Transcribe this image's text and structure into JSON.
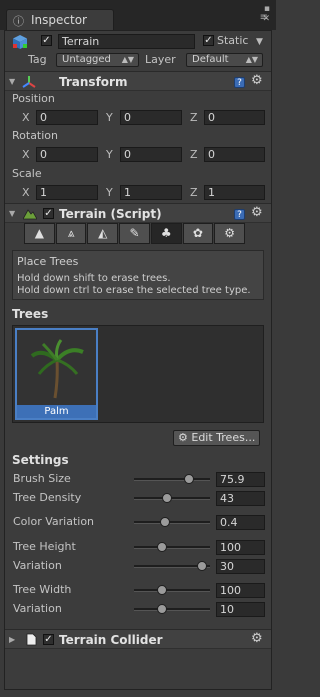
{
  "window": {
    "tab_label": "Inspector",
    "tab_icon": "info-icon"
  },
  "object": {
    "icon": "gameobject-cube-icon",
    "active": true,
    "name": "Terrain",
    "static_checked": true,
    "static_label": "Static",
    "tag_label": "Tag",
    "tag_value": "Untagged",
    "layer_label": "Layer",
    "layer_value": "Default"
  },
  "transform": {
    "title": "Transform",
    "position_label": "Position",
    "rotation_label": "Rotation",
    "scale_label": "Scale",
    "axis_x": "X",
    "axis_y": "Y",
    "axis_z": "Z",
    "position": {
      "x": "0",
      "y": "0",
      "z": "0"
    },
    "rotation": {
      "x": "0",
      "y": "0",
      "z": "0"
    },
    "scale": {
      "x": "1",
      "y": "1",
      "z": "1"
    }
  },
  "terrain_script": {
    "title": "Terrain (Script)",
    "enabled": true,
    "tools": [
      "raise-lower-icon",
      "paint-height-icon",
      "smooth-height-icon",
      "paint-texture-icon",
      "place-trees-icon",
      "paint-details-icon",
      "settings-icon"
    ],
    "active_tool_index": 4,
    "help_title": "Place Trees",
    "help_line1": "Hold down shift to erase trees.",
    "help_line2": "Hold down ctrl to erase the selected tree type.",
    "trees_label": "Trees",
    "trees": [
      {
        "name": "Palm"
      }
    ],
    "edit_trees_label": "Edit Trees...",
    "edit_trees_icon": "gear-icon",
    "settings_label": "Settings",
    "brush_size_label": "Brush Size",
    "brush_size": "75.9",
    "tree_density_label": "Tree Density",
    "tree_density": "43",
    "color_variation_label": "Color Variation",
    "color_variation": "0.4",
    "tree_height_label": "Tree Height",
    "tree_height": "100",
    "height_variation_label": "Variation",
    "height_variation": "30",
    "tree_width_label": "Tree Width",
    "tree_width": "100",
    "width_variation_label": "Variation",
    "width_variation": "10"
  },
  "sliders": {
    "brush_size": 0.76,
    "tree_density": 0.43,
    "color_variation": 0.4,
    "tree_height": 0.35,
    "height_variation": 0.95,
    "tree_width": 0.35,
    "width_variation": 0.35
  },
  "collider": {
    "title": "Terrain Collider",
    "enabled": true
  },
  "colors": {
    "selection_blue": "#3d70b7",
    "panel_bg": "#3c3c3c"
  }
}
